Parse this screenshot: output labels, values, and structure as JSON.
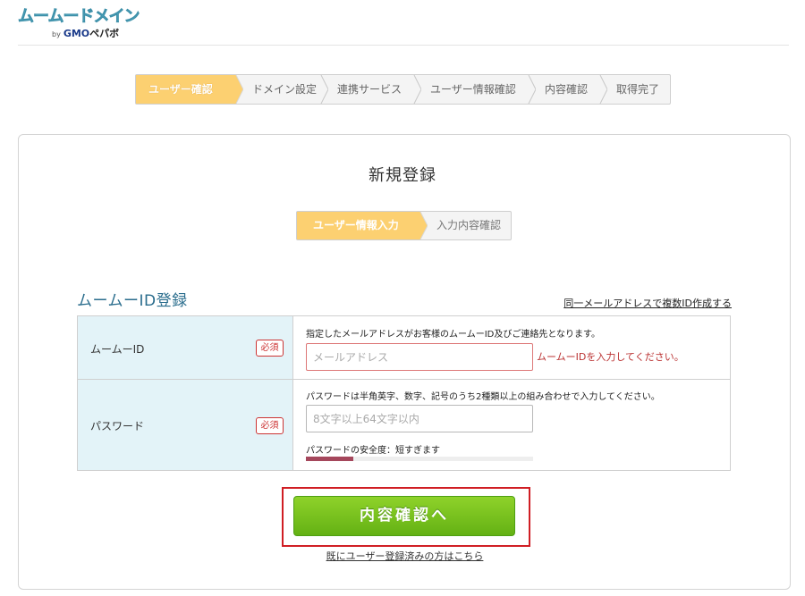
{
  "header": {
    "logo_text": "ムームードメイン",
    "logo_by": "by",
    "logo_gmo": "GMO",
    "logo_pepabo": "ペパボ"
  },
  "progress": {
    "steps": [
      {
        "label": "ユーザー確認",
        "active": true
      },
      {
        "label": "ドメイン設定",
        "active": false
      },
      {
        "label": "連携サービス",
        "active": false
      },
      {
        "label": "ユーザー情報確認",
        "active": false
      },
      {
        "label": "内容確認",
        "active": false
      },
      {
        "label": "取得完了",
        "active": false
      }
    ]
  },
  "panel": {
    "title": "新規登録",
    "substeps": [
      {
        "label": "ユーザー情報入力",
        "active": true
      },
      {
        "label": "入力内容確認",
        "active": false
      }
    ],
    "section_title": "ムームーID登録",
    "multi_link": "同一メールアドレスで複数ID作成する"
  },
  "form": {
    "id_row": {
      "label": "ムームーID",
      "required": "必須",
      "hint": "指定したメールアドレスがお客様のムームーID及びご連絡先となります。",
      "placeholder": "メールアドレス",
      "value": "",
      "error": "ムームーIDを入力してください。"
    },
    "password_row": {
      "label": "パスワード",
      "required": "必須",
      "hint": "パスワードは半角英字、数字、記号のうち2種類以上の組み合わせで入力してください。",
      "placeholder": "8文字以上64文字以内",
      "value": "",
      "strength_label": "パスワードの安全度：短すぎます",
      "strength_level": 0.21
    }
  },
  "actions": {
    "submit_label": "内容確認へ",
    "login_link": "既にユーザー登録済みの方はこちら"
  },
  "colors": {
    "active_step": "#fcd071",
    "section_title": "#2a6d8d",
    "label_bg": "#e3f3f8",
    "required": "#cc3333",
    "button_green": "#6bb816",
    "highlight_red": "#d01e24",
    "strength_fill": "#a5475c"
  }
}
